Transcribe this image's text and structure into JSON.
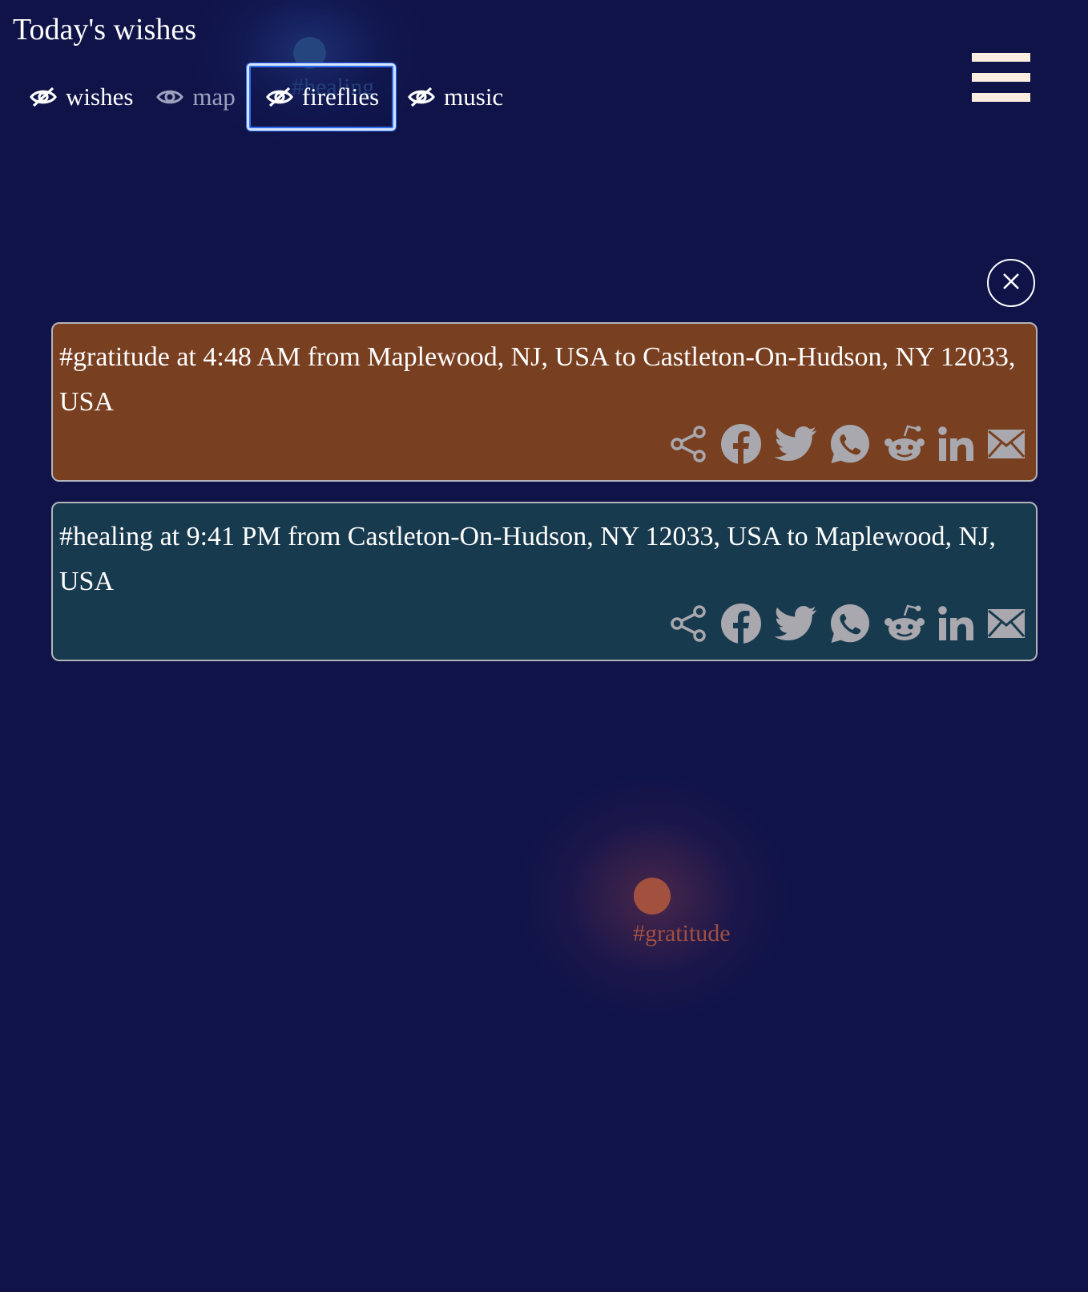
{
  "header": {
    "title": "Today's wishes"
  },
  "toggles": [
    {
      "label": "wishes",
      "icon": "eye-slash-icon",
      "state": "hidden"
    },
    {
      "label": "map",
      "icon": "eye-icon",
      "state": "visible"
    },
    {
      "label": "fireflies",
      "icon": "eye-slash-icon",
      "state": "hidden"
    },
    {
      "label": "music",
      "icon": "eye-slash-icon",
      "state": "hidden"
    }
  ],
  "menu": {
    "icon": "hamburger-menu-icon"
  },
  "dialog": {
    "close_icon": "close-icon",
    "wishes": [
      {
        "text": "#gratitude at 4:48 AM from Maplewood, NJ, USA to Castleton-On-Hudson, NY 12033, USA",
        "color": "#793f21"
      },
      {
        "text": "#healing at 9:41 PM from Castleton-On-Hudson, NY 12033, USA to Maplewood, NJ, USA",
        "color": "#183a4e"
      }
    ],
    "share_icons": [
      "share-icon",
      "facebook-icon",
      "twitter-icon",
      "whatsapp-icon",
      "reddit-icon",
      "linkedin-icon",
      "email-icon"
    ]
  },
  "fireflies": [
    {
      "label": "#healing",
      "color": "#274a86"
    },
    {
      "label": "#gratitude",
      "color": "#a14f40"
    }
  ]
}
